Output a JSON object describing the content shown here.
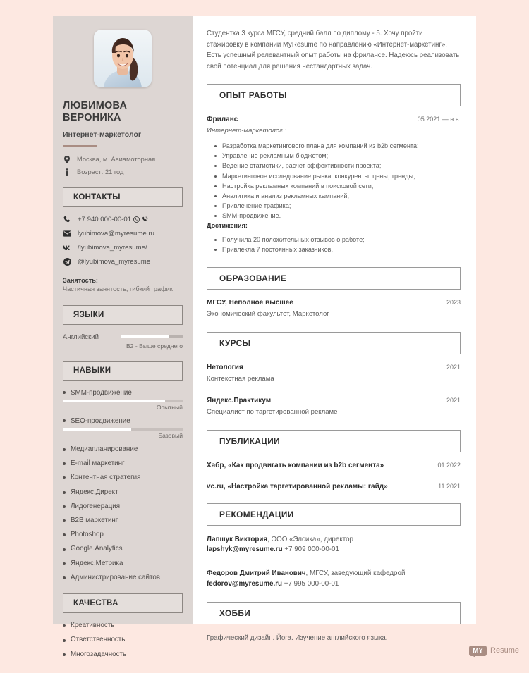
{
  "theme": {
    "page_bg": "#fde8e1",
    "sidebar_bg": "#ddd6d3",
    "accent": "#a98d83",
    "card_bg": "#ffffff"
  },
  "sidebar": {
    "photo_alt": "portrait-photo",
    "name": "ЛЮБИМОВА ВЕРОНИКА",
    "job_title": "Интернет-маркетолог",
    "info": [
      {
        "icon": "location-pin-icon",
        "text": "Москва, м. Авиамоторная"
      },
      {
        "icon": "info-circle-icon",
        "text": "Возраст: 21 год"
      }
    ],
    "contacts_heading": "КОНТАКТЫ",
    "contacts": [
      {
        "icon": "phone-icon",
        "text": "+7 940 000-00-01",
        "extra_icons": [
          "whatsapp-icon",
          "viber-icon"
        ]
      },
      {
        "icon": "envelope-icon",
        "text": "lyubimova@myresume.ru",
        "extra_icons": []
      },
      {
        "icon": "vk-icon",
        "text": "/lyubimova_myresume/",
        "extra_icons": []
      },
      {
        "icon": "telegram-icon",
        "text": "@lyubimova_myresume",
        "extra_icons": []
      }
    ],
    "employment_label": "Занятость:",
    "employment_value": "Частичная занятость, гибкий график",
    "languages_heading": "ЯЗЫКИ",
    "languages": [
      {
        "name": "Английский",
        "level": "B2 - Выше среднего",
        "percent": 78
      }
    ],
    "skills_heading": "НАВЫКИ",
    "rated_skills": [
      {
        "name": "SMM-продвижение",
        "level": "Опытный",
        "percent": 85
      },
      {
        "name": "SEO-продвижение",
        "level": "Базовый",
        "percent": 57
      }
    ],
    "plain_skills": [
      "Медиапланирование",
      "E-mail маркетинг",
      "Контентная стратегия",
      "Яндекс.Директ",
      "Лидогенерация",
      "B2B маркетинг",
      "Photoshop",
      "Google.Analytics",
      "Яндекс.Метрика",
      "Администрирование сайтов"
    ],
    "qualities_heading": "КАЧЕСТВА",
    "qualities": [
      "Креативность",
      "Ответственность",
      "Многозадачность"
    ]
  },
  "main": {
    "summary": "Студентка 3 курса МГСУ, средний балл по диплому - 5. Хочу пройти стажировку в компании MyResume по направлению «Интернет-маркетинг». Есть успешный релевантный опыт работы на фрилансе. Надеюсь реализовать свой потенциал для решения нестандартных задач.",
    "experience_heading": "ОПЫТ РАБОТЫ",
    "experience": {
      "company": "Фриланс",
      "date": "05.2021 — н.в.",
      "role": "Интернет-маркетолог :",
      "duties": [
        "Разработка маркетингового плана для компаний из b2b сегмента;",
        "Управление рекламным бюджетом;",
        "Ведение статистики, расчет эффективности проекта;",
        "Маркетинговое исследование рынка: конкуренты, цены, тренды;",
        "Настройка рекламных компаний в поисковой сети;",
        "Аналитика и анализ рекламных кампаний;",
        "Привлечение трафика;",
        "SMM-продвижение."
      ],
      "achievements_label": "Достижения:",
      "achievements": [
        "Получила 20 положительных отзывов о работе;",
        "Привлекла 7 постоянных заказчиков."
      ]
    },
    "education_heading": "ОБРАЗОВАНИЕ",
    "education": [
      {
        "title": "МГСУ, Неполное высшее",
        "date": "2023",
        "detail": "Экономический факультет, Маркетолог"
      }
    ],
    "courses_heading": "КУРСЫ",
    "courses": [
      {
        "title": "Нетология",
        "date": "2021",
        "detail": "Контекстная реклама"
      },
      {
        "title": "Яндекс.Практикум",
        "date": "2021",
        "detail": "Специалист по таргетированной рекламе"
      }
    ],
    "publications_heading": "ПУБЛИКАЦИИ",
    "publications": [
      {
        "title": "Хабр, «Как продвигать компании из b2b сегмента»",
        "date": "01.2022"
      },
      {
        "title": "vc.ru, «Настройка таргетированной рекламы: гайд»",
        "date": "11.2021"
      }
    ],
    "recommendations_heading": "РЕКОМЕНДАЦИИ",
    "recommendations": [
      {
        "name": "Лапшук Виктория",
        "position": ", ООО «Элсика», директор",
        "email": "lapshyk@myresume.ru",
        "phone": "+7 909 000-00-01"
      },
      {
        "name": "Федоров Дмитрий Иванович",
        "position": ", МГСУ, заведующий кафедрой",
        "email": "fedorov@myresume.ru",
        "phone": "+7 995 000-00-01"
      }
    ],
    "hobby_heading": "ХОББИ",
    "hobby_text": "Графический дизайн. Йога. Изучение английского языка."
  },
  "logo": {
    "badge": "MY",
    "word": "Resume"
  }
}
